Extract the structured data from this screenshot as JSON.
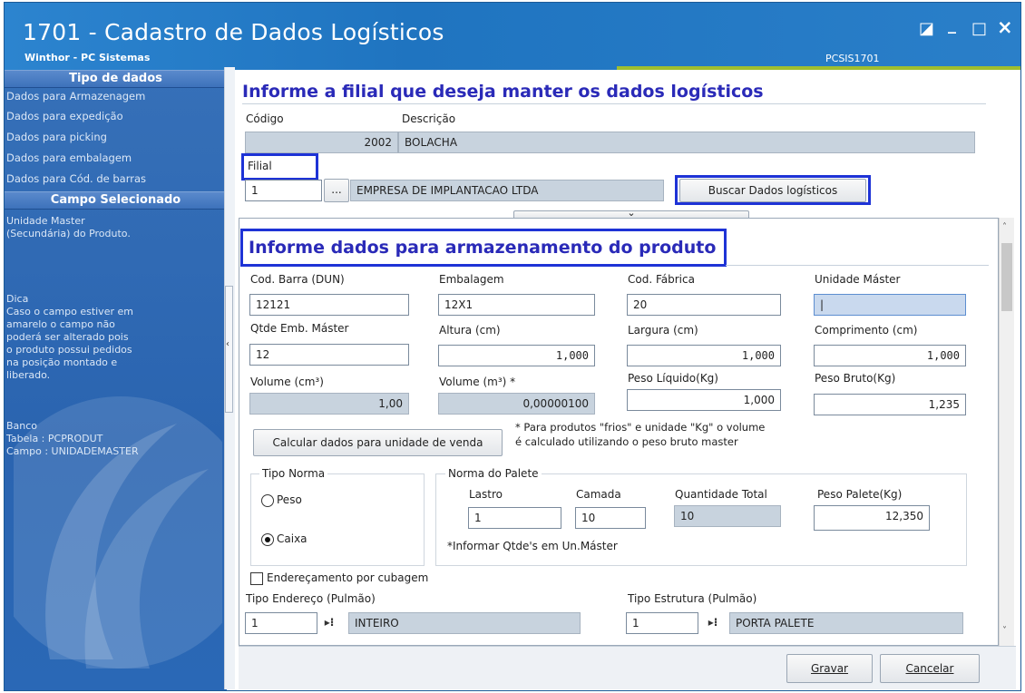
{
  "window": {
    "title": "1701 - Cadastro de Dados Logísticos",
    "subtitle": "Winthor - PC Sistemas",
    "program_code": "PCSIS1701",
    "buttons": {
      "restore": "◪",
      "minimize": "_",
      "maximize": "□",
      "close": "×"
    }
  },
  "sidebar": {
    "section1_title": "Tipo de dados",
    "items": [
      {
        "label": "Dados para Armazenagem"
      },
      {
        "label": "Dados para expedição"
      },
      {
        "label": "Dados para picking"
      },
      {
        "label": "Dados para embalagem"
      },
      {
        "label": "Dados para Cód. de barras"
      }
    ],
    "section2_title": "Campo Selecionado",
    "field_desc": [
      "Unidade Master",
      "(Secundária) do Produto."
    ],
    "tip": [
      "Dica",
      "Caso o campo estiver em",
      "amarelo o campo não",
      "poderá ser alterado pois",
      "o produto possui pedidos",
      "na posição montado e",
      "liberado."
    ],
    "db": [
      "Banco",
      "Tabela : PCPRODUT",
      "Campo : UNIDADEMASTER"
    ]
  },
  "filial_section": {
    "heading": "Informe a filial que deseja manter os dados logísticos",
    "codigo_label": "Código",
    "codigo_value": "2002",
    "descricao_label": "Descrição",
    "descricao_value": "BOLACHA",
    "filial_label": "Filial",
    "filial_value": "1",
    "filial_btn": "...",
    "filial_name": "EMPRESA DE IMPLANTACAO LTDA",
    "buscar_btn": "Buscar Dados logísticos",
    "collapse_icon": "⌄"
  },
  "storage_section": {
    "heading": "Informe dados para armazenamento do produto",
    "fields": {
      "cod_barra_label": "Cod. Barra (DUN)",
      "cod_barra_value": "12121",
      "embalagem_label": "Embalagem",
      "embalagem_value": "12X1",
      "cod_fabrica_label": "Cod. Fábrica",
      "cod_fabrica_value": "20",
      "unidade_master_label": "Unidade Máster",
      "unidade_master_value": "|",
      "qtde_emb_label": "Qtde Emb. Máster",
      "qtde_emb_value": "12",
      "altura_label": "Altura (cm)",
      "altura_value": "1,000",
      "largura_label": "Largura (cm)",
      "largura_value": "1,000",
      "comprimento_label": "Comprimento (cm)",
      "comprimento_value": "1,000",
      "volume_cm_label": "Volume (cm³)",
      "volume_cm_value": "1,00",
      "volume_m_label": "Volume (m³) *",
      "volume_m_value": "0,00000100",
      "peso_liquido_label": "Peso Líquido(Kg)",
      "peso_liquido_value": "1,000",
      "peso_bruto_label": "Peso Bruto(Kg)",
      "peso_bruto_value": "1,235"
    },
    "calc_btn": "Calcular dados para unidade de venda",
    "note_line1": "* Para produtos \"frios\" e unidade \"Kg\" o volume",
    "note_line2": "é calculado utilizando o peso bruto master",
    "tipo_norma": {
      "title": "Tipo Norma",
      "options": [
        {
          "label": "Peso",
          "checked": false
        },
        {
          "label": "Caixa",
          "checked": true
        }
      ]
    },
    "norma_palete": {
      "title": "Norma do Palete",
      "lastro_label": "Lastro",
      "lastro_value": "1",
      "camada_label": "Camada",
      "camada_value": "10",
      "qtd_total_label": "Quantidade Total",
      "qtd_total_value": "10",
      "peso_palete_label": "Peso Palete(Kg)",
      "peso_palete_value": "12,350",
      "note": "*Informar Qtde's em Un.Máster"
    },
    "enderecamento_label": "Endereçamento por cubagem",
    "tipo_endereco_label": "Tipo Endereço (Pulmão)",
    "tipo_endereco_value": "1",
    "tipo_endereco_name": "INTEIRO",
    "tipo_estrutura_label": "Tipo Estrutura (Pulmão)",
    "tipo_estrutura_value": "1",
    "tipo_estrutura_name": "PORTA PALETE"
  },
  "footer": {
    "gravar": "Gravar",
    "cancelar": "Cancelar"
  }
}
